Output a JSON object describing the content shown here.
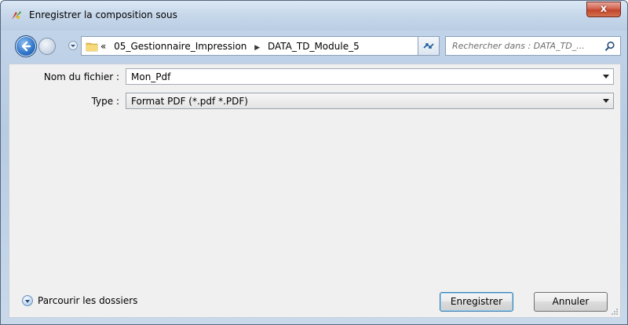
{
  "window": {
    "title": "Enregistrer la composition sous",
    "close_label": "x"
  },
  "nav": {
    "crumb_prefix": "«",
    "crumbs": [
      "05_Gestionnaire_Impression",
      "DATA_TD_Module_5"
    ],
    "search_placeholder": "Rechercher dans : DATA_TD_..."
  },
  "form": {
    "filename_label": "Nom du fichier :",
    "filename_value": "Mon_Pdf",
    "type_label": "Type :",
    "type_value": "Format PDF (*.pdf *.PDF)"
  },
  "footer": {
    "browse_label": "Parcourir les dossiers",
    "save_label": "Enregistrer",
    "cancel_label": "Annuler"
  }
}
